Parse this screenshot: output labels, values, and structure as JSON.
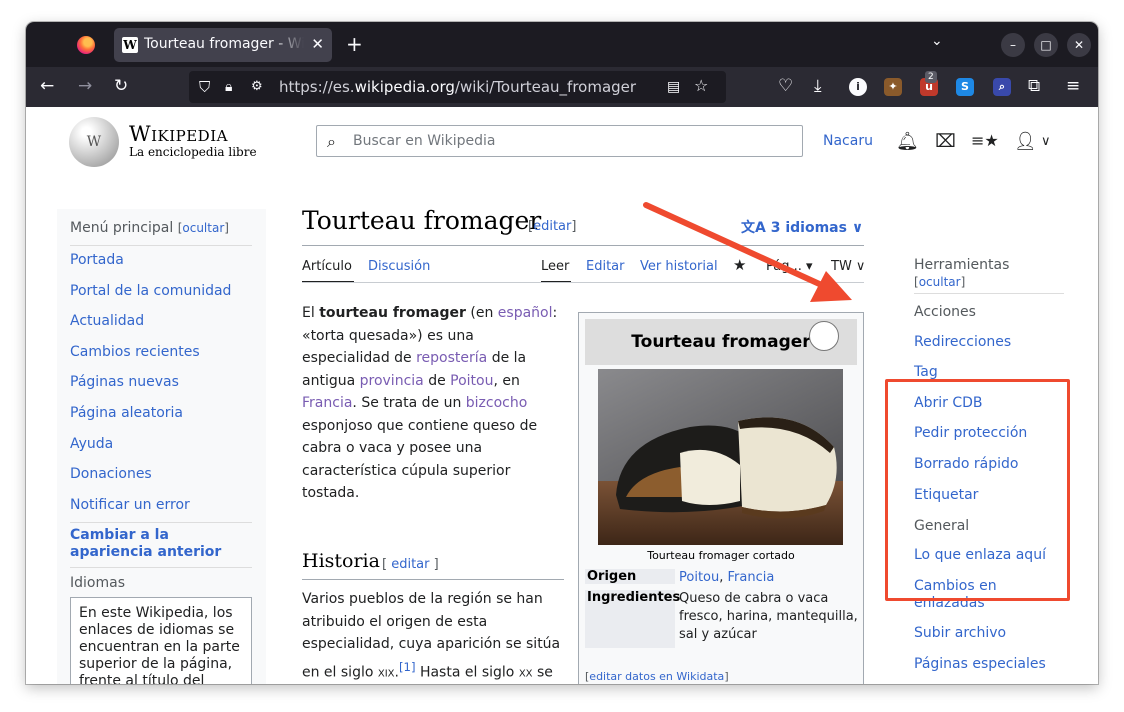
{
  "browser": {
    "tab_title": "Tourteau fromager - Wiki",
    "tab_favicon": "W",
    "url_prefix": "https://es.",
    "url_domain": "wikipedia.org",
    "url_path": "/wiki/Tourteau_fromager",
    "ext_badge": "2"
  },
  "header": {
    "logo_word": "Wikipedia",
    "logo_tagline": "La enciclopedia libre",
    "search_placeholder": "Buscar en Wikipedia",
    "user_link": "Nacaru"
  },
  "left_sidebar": {
    "title": "Menú principal",
    "hide_label": "ocultar",
    "items": [
      "Portada",
      "Portal de la comunidad",
      "Actualidad",
      "Cambios recientes",
      "Páginas nuevas",
      "Página aleatoria",
      "Ayuda",
      "Donaciones",
      "Notificar un error"
    ],
    "switch_appearance": "Cambiar a la apariencia anterior",
    "languages_title": "Idiomas",
    "languages_note": "En este Wikipedia, los enlaces de idiomas se encuentran en la parte superior de la página, frente al título del"
  },
  "article": {
    "title": "Tourteau fromager",
    "edit_label": "editar",
    "languages_button": "3 idiomas",
    "tabs": {
      "article": "Artículo",
      "discussion": "Discusión",
      "read": "Leer",
      "edit": "Editar",
      "history": "Ver historial",
      "more": "Pág... ▾",
      "tw": "TW"
    },
    "intro": {
      "p1": "El ",
      "bold": "tourteau fromager",
      "p2": " (en ",
      "l_espanol": "español",
      "p3": ": «torta quesada») es una especialidad de ",
      "l_reposteria": "repostería",
      "p4": " de la antigua ",
      "l_provincia": "provincia",
      "p5": " de ",
      "l_poitou": "Poitou",
      "p6": ", en ",
      "l_francia": "Francia",
      "p7": ". Se trata de un ",
      "l_bizcocho": "bizcocho",
      "p8": " esponjoso que contiene queso de cabra o vaca y posee una característica cúpula superior tostada."
    },
    "history_title": "Historia",
    "history_edit": "editar",
    "history_text_1": "Varios pueblos de la región se han atribuido el origen de esta especialidad, cuya aparición se sitúa en el siglo ",
    "history_century_1": "xix.",
    "history_ref": "[1]",
    "history_text_2": " Hasta el siglo ",
    "history_century_2": "xx",
    "history_text_3": " se trataba de una pieza de repostería"
  },
  "infobox": {
    "title": "Tourteau fromager",
    "caption": "Tourteau fromager cortado",
    "origin_label": "Origen",
    "origin_value_1": "Poitou",
    "origin_sep": ", ",
    "origin_value_2": "Francia",
    "ingredients_label": "Ingredientes",
    "ingredients_value": "Queso de cabra o vaca fresco, harina, mantequilla, sal y azúcar",
    "wikidata_link": "editar datos en Wikidata"
  },
  "tools": {
    "title": "Herramientas",
    "hide_label": "ocultar",
    "actions_title": "Acciones",
    "actions": [
      "Redirecciones",
      "Tag",
      "Abrir CDB",
      "Pedir protección",
      "Borrado rápido",
      "Etiquetar"
    ],
    "general_title": "General",
    "general": [
      "Lo que enlaza aquí",
      "Cambios en enlazadas",
      "Subir archivo",
      "Páginas especiales"
    ]
  },
  "colors": {
    "link": "#3366cc",
    "visited": "#795cb2",
    "annotation": "#ef4a2f"
  }
}
